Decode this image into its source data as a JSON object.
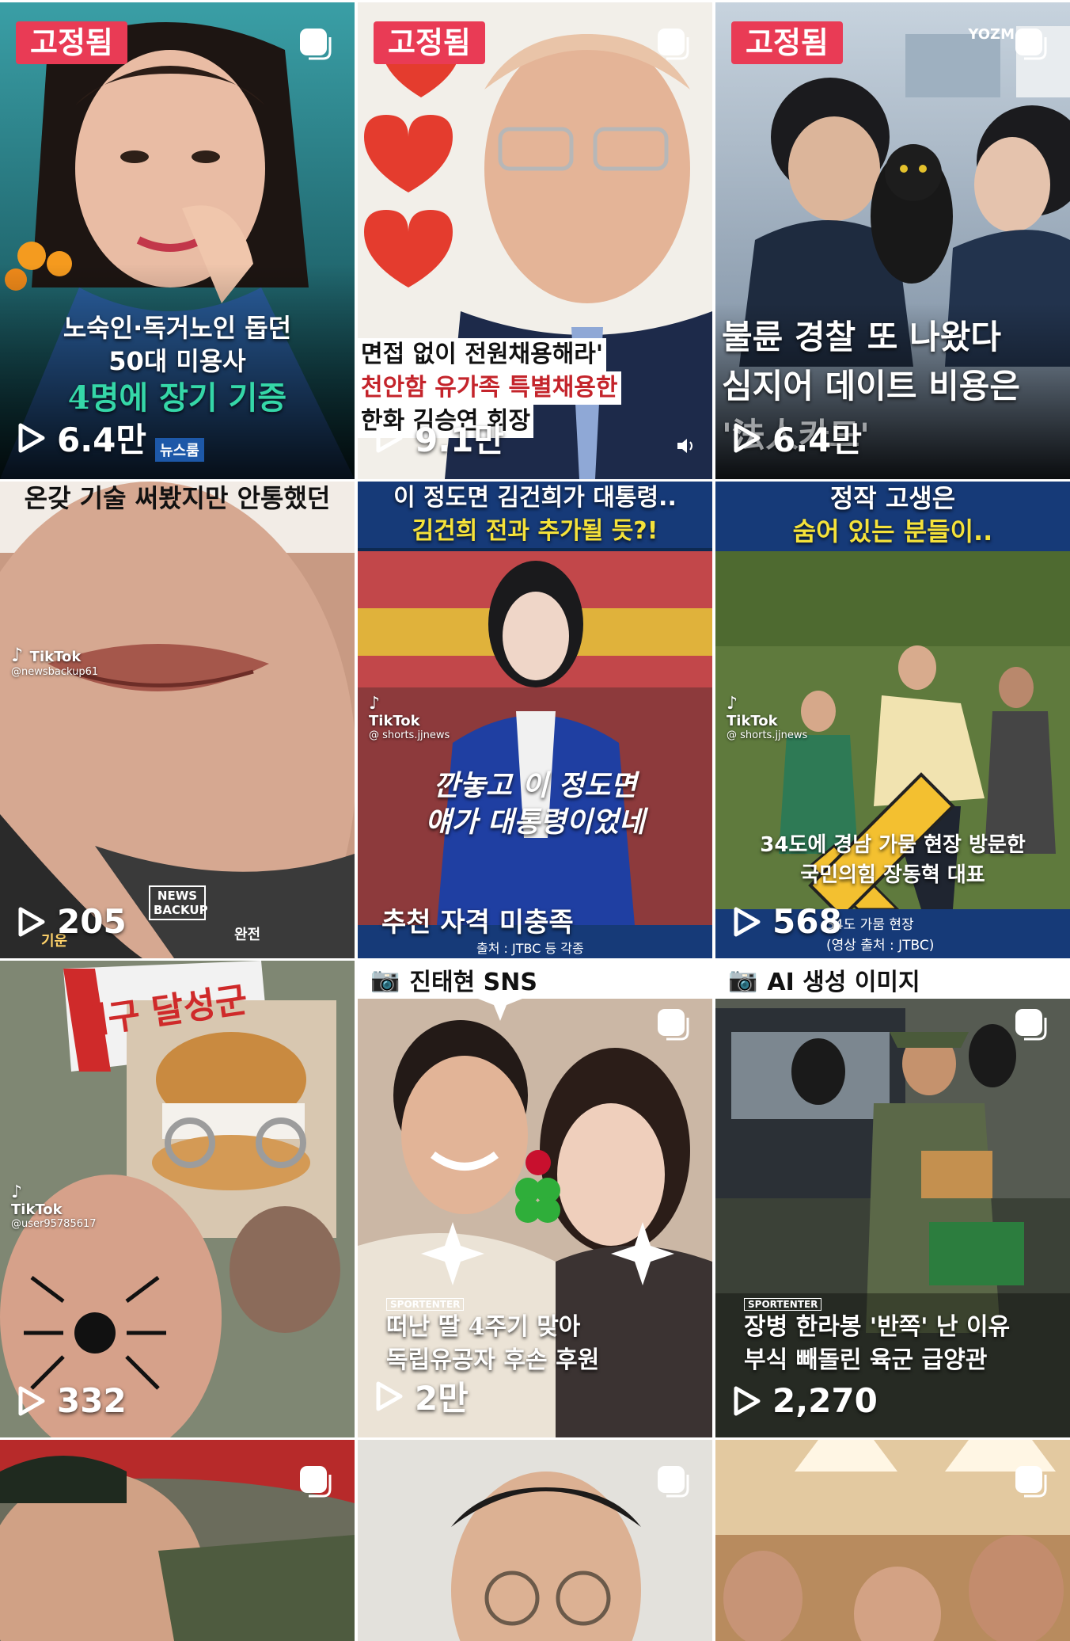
{
  "pinned_label": "고정됨",
  "tiles": [
    {
      "caption_lines": [
        "노숙인·독거노인 돕던",
        "50대 미용사",
        "4명에 장기 기증"
      ],
      "views": "6.4만",
      "watermark": "뉴스룸"
    },
    {
      "caption_lines": [
        "면접 없이 전원채용해라'",
        "천안함 유가족 특별채용한",
        "한화 김승연 회장"
      ],
      "views": "9.1만"
    },
    {
      "caption_lines": [
        "불륜 경찰 또 나왔다",
        "심지어 데이트 비용은",
        "'法人카드'"
      ],
      "views": "6.4만",
      "watermark": "YOZM"
    },
    {
      "top_caption": "온갖 기술 써봤지만 안통했던",
      "top_caption_highlight": "안통했던",
      "tiktok": "TikTok",
      "tiktok_handle": "@newsbackup61",
      "logo": "NEWS BACKUP",
      "views": "205",
      "bottom_left": "기운",
      "bottom_right": "완전"
    },
    {
      "headline_lines": [
        "이 정도면 김건희가 대통령..",
        "김건희 전과 추가될 듯?!"
      ],
      "tiktok": "TikTok",
      "tiktok_handle": "@ shorts.jjnews",
      "quote_lines": [
        "깐놓고 이 정도면",
        "얘가 대통령이었네"
      ],
      "bottom_text": "추천 자격 미충족",
      "source": "출처 : JTBC 등 각종"
    },
    {
      "headline_lines": [
        "정작 고생은",
        "숨어 있는 분들이.."
      ],
      "tiktok": "TikTok",
      "tiktok_handle": "@ shorts.jjnews",
      "caption_lines": [
        "34도에 경남 가뭄 현장 방문한",
        "국민의힘 장동혁 대표"
      ],
      "views": "568",
      "sub_caption": "34도 가뭄 현장",
      "source": "(영상 출처 : JTBC)"
    },
    {
      "banner": "대구 달성군",
      "tiktok": "TikTok",
      "tiktok_handle": "@user95785617",
      "views": "332"
    },
    {
      "source_label": "진태현 SNS",
      "tag": "SPORTENTER",
      "caption_lines": [
        "떠난 딸 4주기 맞아",
        "독립유공자 후손 후원"
      ],
      "views": "2만"
    },
    {
      "source_label": "AI 생성 이미지",
      "tag": "SPORTENTER",
      "caption_lines": [
        "장병 한라봉 '반쪽' 난 이유",
        "부식 빼돌린 육군 급양관"
      ],
      "views": "2,270"
    },
    {},
    {},
    {}
  ],
  "colors": {
    "pin": "#e93b55",
    "caption_green": "#35d7a8",
    "caption_yellow": "#f5e23a",
    "caption_red": "#ff6a33"
  }
}
